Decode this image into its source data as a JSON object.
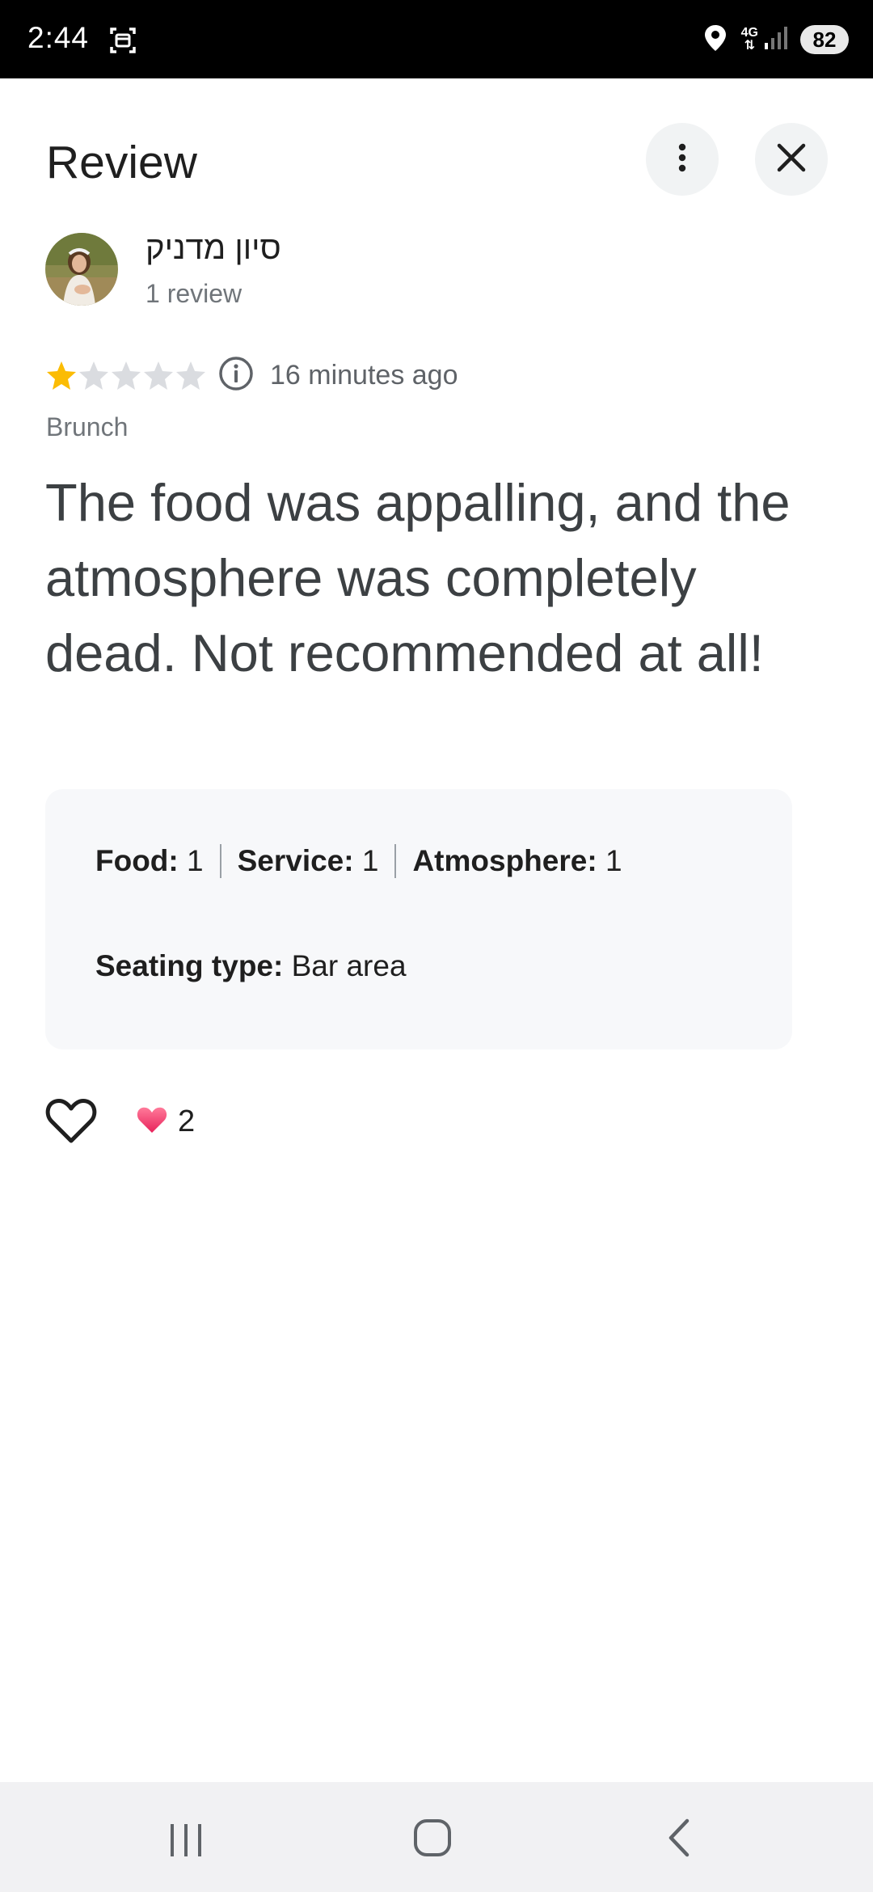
{
  "status_bar": {
    "time": "2:44",
    "network": "4G",
    "battery": "82",
    "icons": [
      "screenshot-icon",
      "location-icon",
      "signal-icon",
      "battery-icon"
    ]
  },
  "header": {
    "title": "Review",
    "more_icon": "more-vert-icon",
    "close_icon": "close-icon"
  },
  "reviewer": {
    "name": "סיון מדניק",
    "meta": "1 review"
  },
  "rating": {
    "stars": 1,
    "max_stars": 5,
    "time_ago": "16 minutes ago",
    "star_color": "#fbbc04",
    "empty_star_color": "#dadce0"
  },
  "review": {
    "meal_type": "Brunch",
    "text": "The food was appalling, and the atmosphere was completely dead. Not recommended at all!"
  },
  "attributes": {
    "food_label": "Food:",
    "food_value": "1",
    "service_label": "Service:",
    "service_value": "1",
    "atmosphere_label": "Atmosphere:",
    "atmosphere_value": "1",
    "seating_label": "Seating type:",
    "seating_value": "Bar area"
  },
  "reactions": {
    "like_icon": "heart-outline-icon",
    "reaction_icon": "heart-filled-icon",
    "count": "2"
  },
  "nav_bar": {
    "icons": [
      "recent-apps-icon",
      "home-icon",
      "back-icon"
    ]
  }
}
